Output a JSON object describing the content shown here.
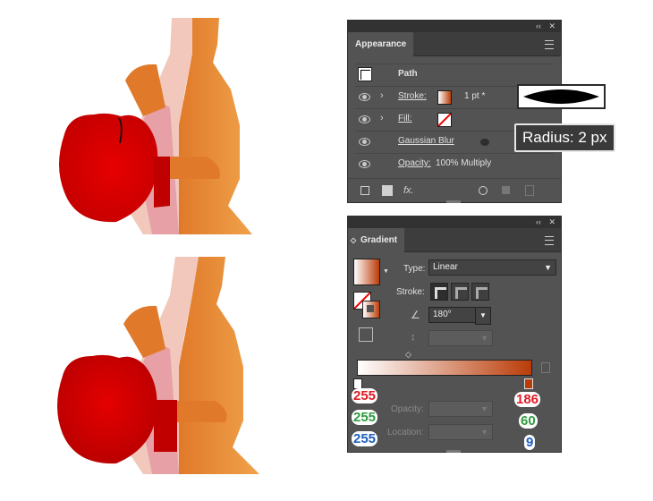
{
  "appearance": {
    "tab_label": "Appearance",
    "rows": {
      "path_label": "Path",
      "stroke_label": "Stroke:",
      "stroke_value": "1 pt *",
      "fill_label": "Fill:",
      "effect_label": "Gaussian Blur",
      "opacity_label": "Opacity:",
      "opacity_value": "100% Multiply"
    },
    "footer_icons": [
      "new-stroke-icon",
      "new-fill-icon",
      "fx-icon",
      "clear-icon",
      "duplicate-icon",
      "trash-icon"
    ],
    "fx_text": "fx."
  },
  "tooltip": {
    "text": "Radius: 2 px"
  },
  "gradient": {
    "tab_label": "Gradient",
    "type_label": "Type:",
    "type_value": "Linear",
    "stroke_label": "Stroke:",
    "angle_value": "180°",
    "opacity_label": "Opacity:",
    "location_label": "Location:",
    "gradient_colors": {
      "start": "#ffffff",
      "end": "#ba3c09"
    }
  },
  "annotations": {
    "left_stop": {
      "r": "255",
      "g": "255",
      "b": "255"
    },
    "right_stop": {
      "r": "186",
      "g": "60",
      "b": "9"
    },
    "colors": {
      "r": "#e01b24",
      "g": "#2e9c3f",
      "b": "#1f5fbf"
    }
  },
  "window_buttons": {
    "collapse": "‹‹",
    "close": "✕"
  }
}
